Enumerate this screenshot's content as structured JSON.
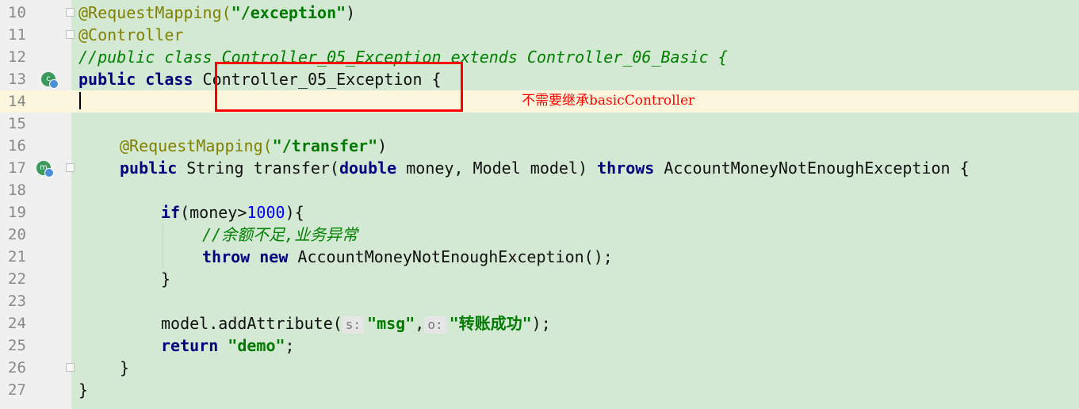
{
  "lines": [
    {
      "n": "10"
    },
    {
      "n": "11"
    },
    {
      "n": "12"
    },
    {
      "n": "13"
    },
    {
      "n": "14"
    },
    {
      "n": "15"
    },
    {
      "n": "16"
    },
    {
      "n": "17"
    },
    {
      "n": "18"
    },
    {
      "n": "19"
    },
    {
      "n": "20"
    },
    {
      "n": "21"
    },
    {
      "n": "22"
    },
    {
      "n": "23"
    },
    {
      "n": "24"
    },
    {
      "n": "25"
    },
    {
      "n": "26"
    },
    {
      "n": "27"
    }
  ],
  "code": {
    "l10_ann": "@RequestMapping(",
    "l10_str": "\"/exception\"",
    "l10_end": ")",
    "l11_ann": "@Controller",
    "l12_cmt": "//public class Controller_05_Exception extends Controller_06_Basic {",
    "l13_kw": "public class",
    "l13_name": " Controller_05_Exception {",
    "l16_ann": "@RequestMapping(",
    "l16_str": "\"/transfer\"",
    "l16_end": ")",
    "l17_kw1": "public",
    "l17_a": " String transfer(",
    "l17_kw2": "double",
    "l17_b": " money, Model model) ",
    "l17_kw3": "throws",
    "l17_c": " AccountMoneyNotEnoughException {",
    "l19_kw": "if",
    "l19_a": "(money>",
    "l19_num": "1000",
    "l19_b": "){",
    "l20_cmt": "//余额不足,业务异常",
    "l21_kw1": "throw",
    "l21_kw2": "new",
    "l21_a": " AccountMoneyNotEnoughException();",
    "l22": "}",
    "l24_a": "model.addAttribute(",
    "l24_hint1": "s:",
    "l24_str1": "\"msg\"",
    "l24_comma": ",",
    "l24_hint2": "o:",
    "l24_str2": "\"转账成功\"",
    "l24_end": ");",
    "l25_kw": "return",
    "l25_str": "\"demo\"",
    "l25_end": ";",
    "l26": "}",
    "l27": "}"
  },
  "annotation": {
    "note": "不需要继承basicController",
    "box_color": "#ff0000"
  },
  "icons": {
    "line13": "class-gutter-icon",
    "line17": "method-gutter-icon"
  }
}
